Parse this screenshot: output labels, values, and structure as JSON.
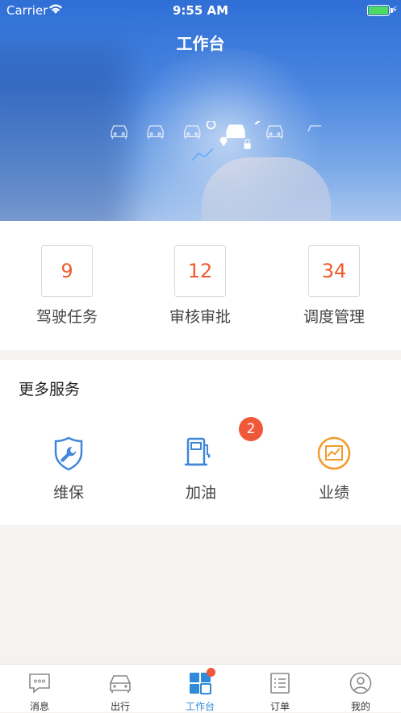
{
  "status_bar": {
    "carrier": "Carrier",
    "time": "9:55 AM"
  },
  "header": {
    "title": "工作台"
  },
  "stats": [
    {
      "value": "9",
      "label": "驾驶任务"
    },
    {
      "value": "12",
      "label": "审核审批"
    },
    {
      "value": "34",
      "label": "调度管理"
    }
  ],
  "services": {
    "title": "更多服务",
    "items": [
      {
        "label": "维保",
        "icon": "wrench-shield-icon",
        "color": "#3f86d9"
      },
      {
        "label": "加油",
        "icon": "fuel-pump-icon",
        "color": "#3f86d9",
        "badge": "2"
      },
      {
        "label": "业绩",
        "icon": "chart-trend-icon",
        "color": "#f39a2a"
      }
    ]
  },
  "tabbar": {
    "items": [
      {
        "label": "消息",
        "icon": "message-icon"
      },
      {
        "label": "出行",
        "icon": "car-icon"
      },
      {
        "label": "工作台",
        "icon": "workbench-grid-icon",
        "active": true
      },
      {
        "label": "订单",
        "icon": "order-list-icon"
      },
      {
        "label": "我的",
        "icon": "profile-icon"
      }
    ]
  },
  "colors": {
    "accent": "#2f8ad8",
    "stat_number": "#f05a2c",
    "badge": "#f0583a"
  }
}
